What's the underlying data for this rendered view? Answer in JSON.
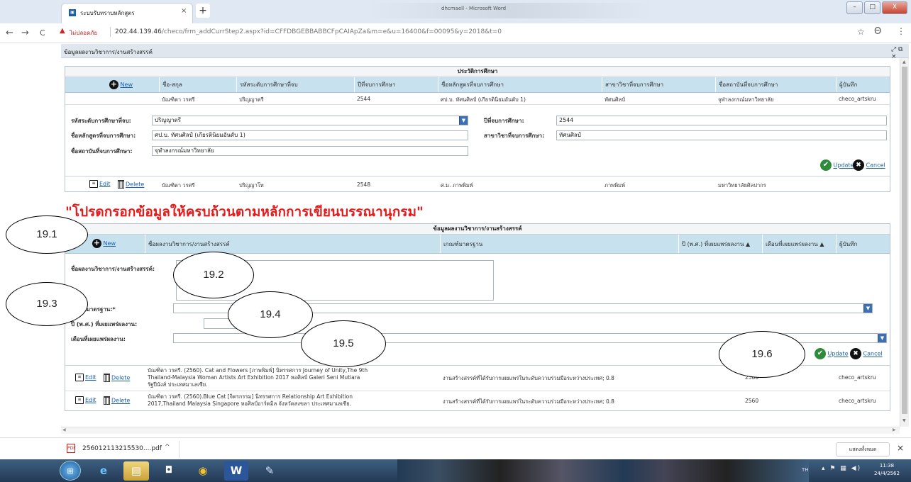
{
  "browser": {
    "tab_title": "ระบบรับทราบหลักสูตร",
    "tab_close": "×",
    "new_tab": "+",
    "window_title": "dhcmaell - Microsoft Word",
    "nav_back": "←",
    "nav_forward": "→",
    "nav_reload": "C",
    "not_secure": "ไม่ปลอดภัย",
    "url_host": "202.44.139.46",
    "url_path": "/checo/frm_addCurrStep2.aspx?id=CFFDBGEBBABBCFpCAIApZa&m=e&u=16400&f=00095&y=2018&t=0",
    "bookmark": "☆",
    "account": "Θ",
    "menu": "⋮",
    "win_min": "–",
    "win_max": "□",
    "win_close": "X"
  },
  "dialog": {
    "title": "ข้อมูลผลงานวิชาการ/งานสร้างสรรค์",
    "controls": "⤢ ⧉ ×"
  },
  "education": {
    "header": "ประวัติการศึกษา",
    "new_label": "New",
    "columns": [
      "ชื่อ-สกุล",
      "รหัสระดับการศึกษาที่จบ",
      "ปีที่จบการศึกษา",
      "ชื่อหลักสูตรที่จบการศึกษา",
      "สาขาวิชาที่จบการศึกษา",
      "ชื่อสถาบันที่จบการศึกษา",
      "ผู้บันทึก"
    ],
    "row1": [
      "บัณฑิตา วรศรี",
      "ปริญญาตรี",
      "2544",
      "ศป.บ. ทัศนศิลป์ (เกียรตินิยมอันดับ 1)",
      "ทัศนศิลป์",
      "จุฬาลงกรณ์มหาวิทยาลัย",
      "checo_artskru"
    ],
    "form": {
      "level_label": "รหัสระดับการศึกษาที่จบ:",
      "level_value": "ปริญญาตรี",
      "year_label": "ปีที่จบการศึกษา:",
      "year_value": "2544",
      "course_label": "ชื่อหลักสูตรที่จบการศึกษา:",
      "course_value": "ศป.บ. ทัศนศิลป์ (เกียรตินิยมอันดับ 1)",
      "major_label": "สาขาวิชาที่จบการศึกษา:",
      "major_value": "ทัศนศิลป์",
      "inst_label": "ชื่อสถาบันที่จบการศึกษา:",
      "inst_value": "จุฬาลงกรณ์มหาวิทยาลัย",
      "update": "Update",
      "cancel": "Cancel"
    },
    "row2": {
      "edit": "Edit",
      "delete": "Delete",
      "cells": [
        "บัณฑิตา วรศรี",
        "ปริญญาโท",
        "2548",
        "ศ.ม. ภาพพิมพ์",
        "ภาพพิมพ์",
        "มหาวิทยาลัยศิลปากร"
      ]
    }
  },
  "warning": "\"โปรดกรอกข้อมูลให้ครบถ้วนตามหลักการเขียนบรรณานุกรม\"",
  "works": {
    "header": "ข้อมูลผลงานวิชาการ/งานสร้างสรรค์",
    "new_label": "New",
    "columns": [
      "ชื่อผลงานวิชาการ/งานสร้างสรรค์",
      "เกณฑ์มาตรฐาน",
      "ปี (พ.ศ.) ที่เผยแพร่ผลงาน ▲",
      "เดือนที่เผยแพร่ผลงาน ▲",
      "ผู้บันทึก"
    ],
    "form": {
      "name_label": "ชื่อผลงานวิชาการ/งานสร้างสรรค์:",
      "std_label": "เกณฑ์มาตรฐาน:*",
      "year_label": "ปี (พ.ศ.) ที่เผยแพร่ผลงาน:",
      "month_label": "เดือนที่เผยแพร่ผลงาน:",
      "update": "Update",
      "cancel": "Cancel"
    },
    "rows": [
      {
        "edit": "Edit",
        "delete": "Delete",
        "title_lines": [
          "บัณฑิตา วรศรี. (2560). Cat and Flowers [ภาพพิมพ์] นิทรรศการ Journey of Unity,The 9th",
          "Thailand-Malaysia Woman Artists Art Exhibition 2017 หอศิลป์ Galeri Seni Mutiara",
          "รัฐปีนังส์ ประเทศมาเลเซีย."
        ],
        "standard": "งานสร้างสรรค์ที่ได้รับการเผยแพร่ในระดับความร่วมมือระหว่างประเทศ; 0.8",
        "year": "2560",
        "recorder": "checo_artskru"
      },
      {
        "edit": "Edit",
        "delete": "Delete",
        "title_lines": [
          "บัณฑิตา วรศรี. (2560).Blue Cat [จิตรกรรม] นิทรรศการ Relationship Art Exhibition",
          "2017,Thailand Malaysia Singapore หอศิลป์อาร์ตมิล จังหวัดสงขลา ประเทศมาเลเซีย."
        ],
        "standard": "งานสร้างสรรค์ที่ได้รับการเผยแพร่ในระดับความร่วมมือระหว่างประเทศ; 0.8",
        "year": "2560",
        "recorder": "checo_artskru"
      }
    ]
  },
  "annotations": [
    "19.1",
    "19.2",
    "19.3",
    "19.4",
    "19.5",
    "19.6"
  ],
  "downloads": {
    "file": "256012113215530....pdf",
    "arrow": "^",
    "show_all": "แสดงทั้งหมด",
    "close": "×"
  },
  "taskbar": {
    "lang": "TH",
    "time": "11:38",
    "date": "24/4/2562"
  }
}
